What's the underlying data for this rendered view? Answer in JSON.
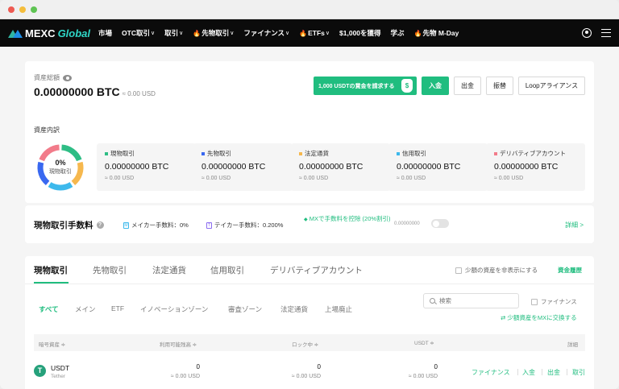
{
  "nav": {
    "logo": {
      "brand": "MEXC",
      "suffix": "Global"
    },
    "items": [
      {
        "label": "市場",
        "chevron": false,
        "fire": false
      },
      {
        "label": "OTC取引",
        "chevron": true,
        "fire": false
      },
      {
        "label": "取引",
        "chevron": true,
        "fire": false
      },
      {
        "label": "先物取引",
        "chevron": true,
        "fire": true
      },
      {
        "label": "ファイナンス",
        "chevron": true,
        "fire": false
      },
      {
        "label": "ETFs",
        "chevron": true,
        "fire": true
      },
      {
        "label": "$1,000を獲得",
        "chevron": false,
        "fire": false
      },
      {
        "label": "学ぶ",
        "chevron": false,
        "fire": false
      },
      {
        "label": "先物 M-Day",
        "chevron": false,
        "fire": true
      }
    ]
  },
  "overview": {
    "label": "資産総額",
    "value": "0.00000000 BTC",
    "usd": "≈ 0.00 USD",
    "promo_label": "1,000 USDTの賞金を請求する",
    "deposit_label": "入金",
    "withdraw_label": "出金",
    "transfer_label": "振替",
    "loop_label": "Loopアライアンス"
  },
  "breakdown": {
    "label": "資産内訳",
    "donut_pct": "0%",
    "donut_sub": "現物取引",
    "segment_colors": [
      "#2ebd85",
      "#f6b84e",
      "#3db9ec",
      "#3968f0",
      "#f27b8a"
    ],
    "accounts": [
      {
        "name": "現物取引",
        "color": "#2ebd85",
        "btc": "0.00000000 BTC",
        "usd": "≈ 0.00 USD"
      },
      {
        "name": "先物取引",
        "color": "#3968f0",
        "btc": "0.00000000 BTC",
        "usd": "≈ 0.00 USD"
      },
      {
        "name": "法定通貨",
        "color": "#f6b84e",
        "btc": "0.00000000 BTC",
        "usd": "≈ 0.00 USD"
      },
      {
        "name": "信用取引",
        "color": "#3db9ec",
        "btc": "0.00000000 BTC",
        "usd": "≈ 0.00 USD"
      },
      {
        "name": "デリバティブアカウント",
        "color": "#f27b8a",
        "btc": "0.00000000 BTC",
        "usd": "≈ 0.00 USD"
      }
    ]
  },
  "fees": {
    "title": "現物取引手数料",
    "maker": "メイカー手数料：0%",
    "taker": "テイカー手数料：0.200%",
    "mx_discount": "MXで手数料を控除 (20%割引)",
    "mx_value": "0.00000000",
    "detail_link": "詳細 >"
  },
  "tabs": {
    "items": [
      "現物取引",
      "先物取引",
      "法定通貨",
      "信用取引",
      "デリバティブアカウント"
    ],
    "active": 0,
    "hide_small": "少額の資産を非表示にする",
    "funds_link": "資金履歴"
  },
  "filters": {
    "items": [
      "すべて",
      "メイン",
      "ETF",
      "イノベーションゾーン",
      "審査ゾーン",
      "法定通貨",
      "上場廃止"
    ],
    "active": 0,
    "search_placeholder": "検索",
    "finance_checkbox": "ファイナンス",
    "convert_link": "少額資産をMXに交換する"
  },
  "table": {
    "headers": [
      "暗号資産 ≑",
      "利用可能残高 ≑",
      "ロック中 ≑",
      "USDT ≑",
      "詳細"
    ],
    "rows": [
      {
        "symbol": "USDT",
        "name": "Tether",
        "available": "0",
        "available_usd": "≈ 0.00 USD",
        "locked": "0",
        "locked_usd": "≈ 0.00 USD",
        "usdt": "0",
        "usdt_usd": "≈ 0.00 USD",
        "actions": [
          "ファイナンス",
          "入金",
          "出金",
          "取引"
        ]
      }
    ]
  }
}
